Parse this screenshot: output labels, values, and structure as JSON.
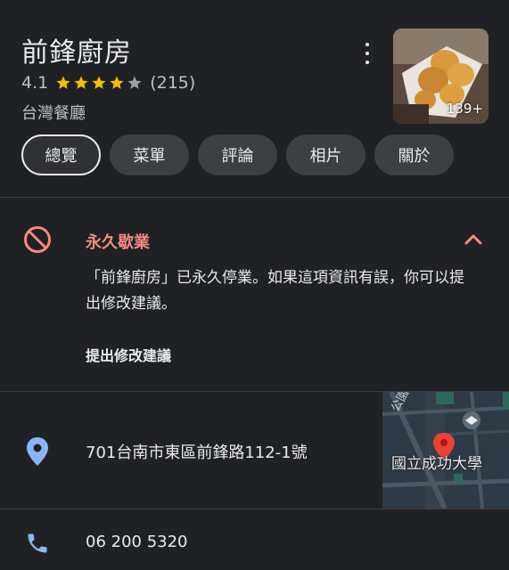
{
  "place": {
    "name": "前鋒廚房",
    "rating": "4.1",
    "review_count": "(215)",
    "category": "台灣餐廳",
    "stars_filled": 4,
    "stars_total": 5,
    "photo_count": "139+"
  },
  "tabs": [
    {
      "label": "總覽",
      "active": true
    },
    {
      "label": "菜單"
    },
    {
      "label": "評論"
    },
    {
      "label": "相片"
    },
    {
      "label": "關於"
    }
  ],
  "status": {
    "title": "永久歇業",
    "description": "「前鋒廚房」已永久停業。如果這項資訊有誤，你可以提出修改建議。",
    "suggest_label": "提出修改建議"
  },
  "address": {
    "text": "701台南市東區前鋒路112-1號",
    "map_label": "國立成功大學",
    "map_road": "公園路"
  },
  "phone": {
    "text": "06 200 5320"
  },
  "colors": {
    "background": "#202124",
    "chip": "#3c4043",
    "closed_red": "#f28b82",
    "icon_blue": "#8ab4f8",
    "star": "#fbbc04"
  },
  "icons": {
    "more": "more-vert-icon",
    "closed": "block-icon",
    "collapse": "chevron-up-icon",
    "address": "location-pin-icon",
    "phone": "phone-icon"
  }
}
